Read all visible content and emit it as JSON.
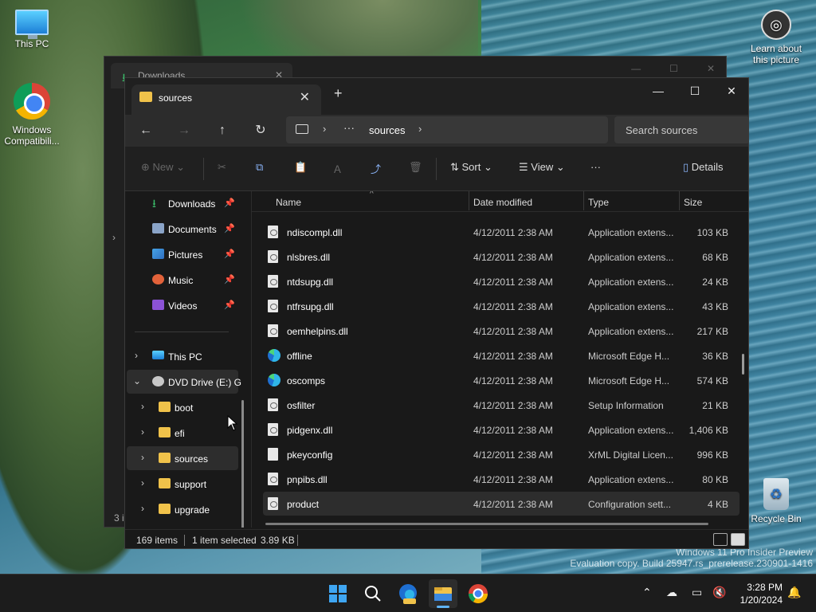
{
  "desktop": {
    "icons": [
      {
        "label": "This PC"
      },
      {
        "label": "Windows Compatibili..."
      },
      {
        "label": "Learn about this picture"
      },
      {
        "label": "Recycle Bin"
      }
    ],
    "watermark": {
      "line1": "Windows 11 Pro Insider Preview",
      "line2": "Evaluation copy. Build 25947.rs_prerelease.230901-1416"
    }
  },
  "back_window": {
    "tab_title": "Downloads",
    "status": "3 i"
  },
  "window": {
    "tab_title": "sources",
    "controls": {
      "minimize": "—",
      "maximize": "☐",
      "close": "✕"
    },
    "address": {
      "ellipsis": "···",
      "current": "sources"
    },
    "search_placeholder": "Search sources",
    "toolbar": {
      "new": "New",
      "sort": "Sort",
      "view": "View",
      "more": "···",
      "details": "Details"
    },
    "nav": {
      "quick_access": [
        {
          "label": "Downloads"
        },
        {
          "label": "Documents"
        },
        {
          "label": "Pictures"
        },
        {
          "label": "Music"
        },
        {
          "label": "Videos"
        }
      ],
      "this_pc": "This PC",
      "dvd": "DVD Drive (E:) G",
      "folders": [
        {
          "label": "boot"
        },
        {
          "label": "efi"
        },
        {
          "label": "sources"
        },
        {
          "label": "support"
        },
        {
          "label": "upgrade"
        }
      ]
    },
    "columns": {
      "name": "Name",
      "date": "Date modified",
      "type": "Type",
      "size": "Size"
    },
    "files": [
      {
        "name": "ndiscompl.dll",
        "date": "4/12/2011 2:38 AM",
        "type": "Application extens...",
        "size": "103 KB",
        "icon": "dll"
      },
      {
        "name": "nlsbres.dll",
        "date": "4/12/2011 2:38 AM",
        "type": "Application extens...",
        "size": "68 KB",
        "icon": "dll"
      },
      {
        "name": "ntdsupg.dll",
        "date": "4/12/2011 2:38 AM",
        "type": "Application extens...",
        "size": "24 KB",
        "icon": "dll"
      },
      {
        "name": "ntfrsupg.dll",
        "date": "4/12/2011 2:38 AM",
        "type": "Application extens...",
        "size": "43 KB",
        "icon": "dll"
      },
      {
        "name": "oemhelpins.dll",
        "date": "4/12/2011 2:38 AM",
        "type": "Application extens...",
        "size": "217 KB",
        "icon": "dll"
      },
      {
        "name": "offline",
        "date": "4/12/2011 2:38 AM",
        "type": "Microsoft Edge H...",
        "size": "36 KB",
        "icon": "edge"
      },
      {
        "name": "oscomps",
        "date": "4/12/2011 2:38 AM",
        "type": "Microsoft Edge H...",
        "size": "574 KB",
        "icon": "edge"
      },
      {
        "name": "osfilter",
        "date": "4/12/2011 2:38 AM",
        "type": "Setup Information",
        "size": "21 KB",
        "icon": "dll"
      },
      {
        "name": "pidgenx.dll",
        "date": "4/12/2011 2:38 AM",
        "type": "Application extens...",
        "size": "1,406 KB",
        "icon": "dll"
      },
      {
        "name": "pkeyconfig",
        "date": "4/12/2011 2:38 AM",
        "type": "XrML Digital Licen...",
        "size": "996 KB",
        "icon": "file"
      },
      {
        "name": "pnpibs.dll",
        "date": "4/12/2011 2:38 AM",
        "type": "Application extens...",
        "size": "80 KB",
        "icon": "dll"
      },
      {
        "name": "product",
        "date": "4/12/2011 2:38 AM",
        "type": "Configuration sett...",
        "size": "4 KB",
        "icon": "dll"
      }
    ],
    "status": {
      "count": "169 items",
      "selected": "1 item selected",
      "size": "3.89 KB"
    }
  },
  "taskbar": {
    "clock_time": "3:28 PM",
    "clock_date": "1/20/2024"
  }
}
